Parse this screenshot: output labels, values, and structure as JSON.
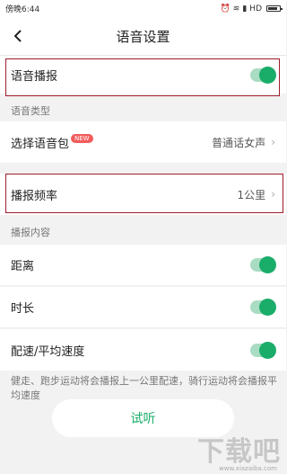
{
  "status_bar": {
    "time": "傍晚6:44",
    "network": "HD"
  },
  "header": {
    "title": "语音设置"
  },
  "rows": {
    "voice_broadcast": "语音播报",
    "voice_type_section": "语音类型",
    "voice_pack": {
      "label": "选择语音包",
      "badge": "NEW",
      "value": "普通话女声"
    },
    "broadcast_frequency": {
      "label": "播报频率",
      "value": "1公里"
    },
    "broadcast_content_section": "播报内容",
    "distance": "距离",
    "duration": "时长",
    "pace": "配速/平均速度"
  },
  "note": "健走、跑步运动将会播报上一公里配速，骑行运动将会播报平均速度",
  "listen_button": "试听",
  "watermark": {
    "text": "下载吧",
    "url": "www.xiazaiba.com"
  },
  "colors": {
    "accent": "#1aad6a",
    "highlight_box": "#a01c2c"
  }
}
